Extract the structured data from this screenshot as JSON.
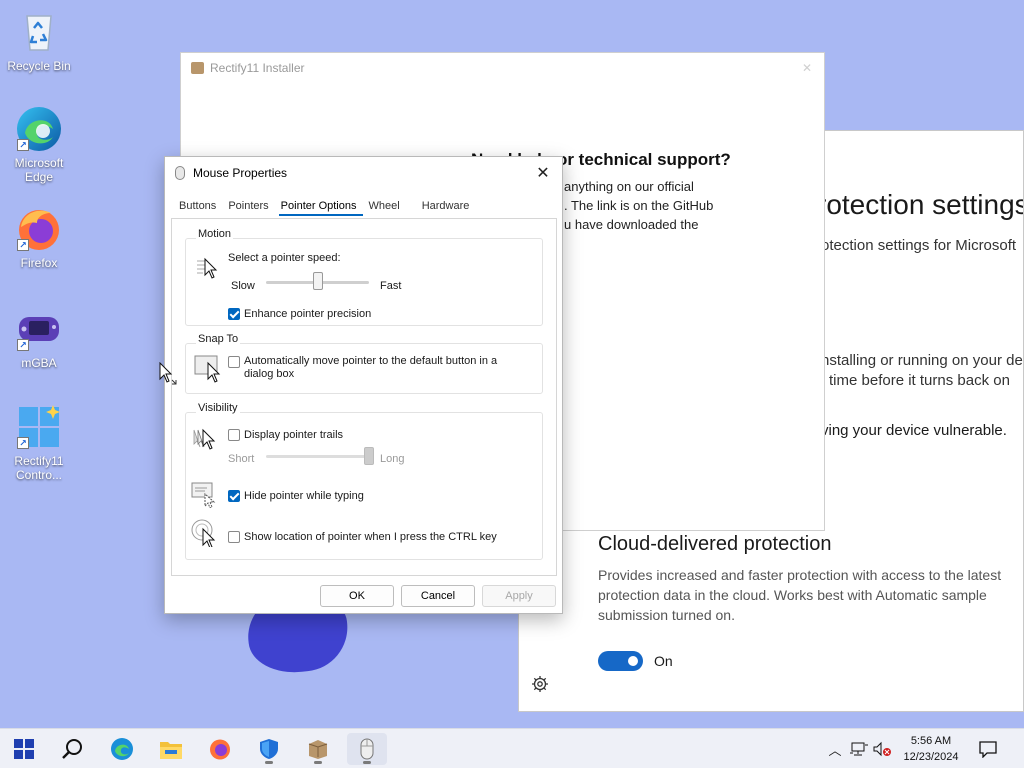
{
  "desktop": {
    "icons": [
      {
        "label": "Recycle Bin"
      },
      {
        "label": "Microsoft Edge"
      },
      {
        "label": "Firefox"
      },
      {
        "label": "mGBA"
      },
      {
        "label": "Rectify11 Contro..."
      }
    ]
  },
  "security_window": {
    "heading": "rotection settings",
    "subheading": "otection settings for Microsoft",
    "line1": "nstalling or running on your de",
    "line2": "time before it turns back on",
    "line3": "ving your device vulnerable.",
    "cloud_title": "Cloud-delivered protection",
    "cloud_desc": "Provides increased and faster protection with access to the latest protection data in the cloud. Works best with Automatic sample submission turned on.",
    "toggle_label": "On",
    "toggle_on": true
  },
  "installer": {
    "title": "Rectify11 Installer",
    "heading": "Need help or technical support?",
    "text_lines": [
      "anything on our official",
      ". The link is on the GitHub",
      "u have downloaded the"
    ]
  },
  "mouse_dialog": {
    "title": "Mouse Properties",
    "tabs": [
      "Buttons",
      "Pointers",
      "Pointer Options",
      "Wheel",
      "Hardware"
    ],
    "active_tab": "Pointer Options",
    "motion": {
      "title": "Motion",
      "speed_label": "Select a pointer speed:",
      "slow": "Slow",
      "fast": "Fast",
      "speed_fraction": 0.5,
      "precision_label": "Enhance pointer precision",
      "precision_checked": true
    },
    "snap_to": {
      "title": "Snap To",
      "label": "Automatically move pointer to the default button in a dialog box",
      "checked": false
    },
    "visibility": {
      "title": "Visibility",
      "trails_label": "Display pointer trails",
      "trails_checked": false,
      "short": "Short",
      "long": "Long",
      "trails_fraction": 1.0,
      "hide_label": "Hide pointer while typing",
      "hide_checked": true,
      "ctrl_label": "Show location of pointer when I press the CTRL key",
      "ctrl_checked": false
    },
    "buttons": {
      "ok": "OK",
      "cancel": "Cancel",
      "apply": "Apply"
    }
  },
  "taskbar": {
    "time": "5:56 AM",
    "date": "12/23/2024",
    "items": [
      "start-icon",
      "search-icon",
      "edge-icon",
      "file-explorer-icon",
      "firefox-icon",
      "security-icon",
      "installer-icon",
      "mouse-icon"
    ]
  }
}
